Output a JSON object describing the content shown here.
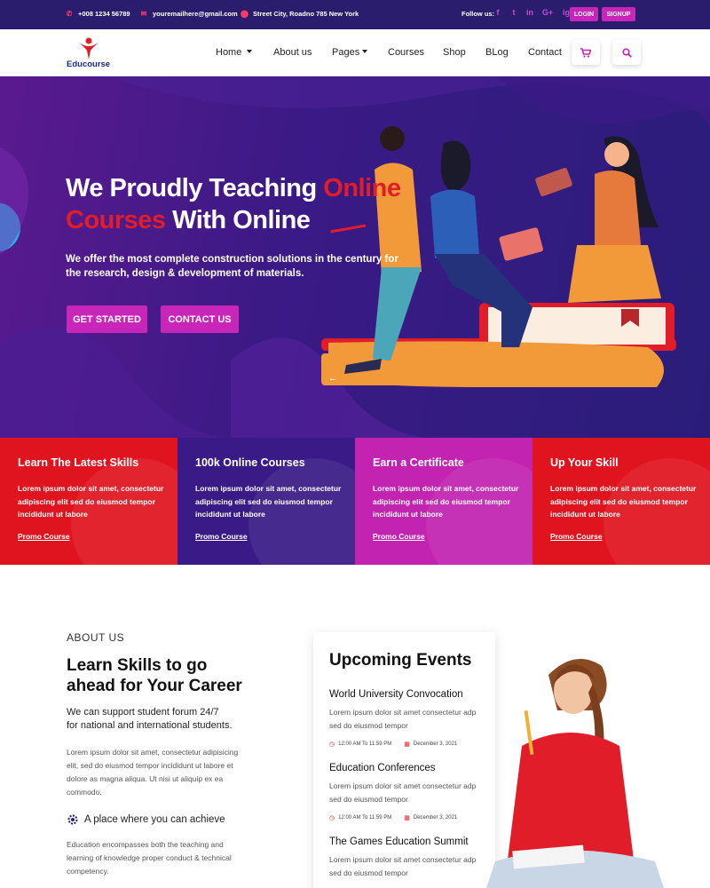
{
  "topbar": {
    "phone": "+008 1234 56789",
    "email": "youremailhere@gmail.com",
    "address": "Street City, Roadno 785 New York",
    "follow_label": "Follow us:",
    "socials": [
      "f",
      "t",
      "in",
      "G+",
      "ig"
    ],
    "login_label": "LOGIN",
    "signup_label": "SIGNUP"
  },
  "brand": {
    "name": "Educourse",
    "accent_color": "#c826b8",
    "red_color": "#e11d2a",
    "navy_color": "#2a1d6e"
  },
  "nav": {
    "items": [
      "Home",
      "About us",
      "Pages",
      "Courses",
      "Shop",
      "BLog",
      "Contact"
    ],
    "icons": [
      "cart-icon",
      "search-icon"
    ]
  },
  "hero": {
    "title_part1": "We Proudly Teaching ",
    "title_highlight1": "Online",
    "title_highlight2": "Courses",
    "title_part2": " With Online",
    "subtitle": "We offer the most complete construction solutions in the century for the research, design & development of materials.",
    "btn_primary": "GET STARTED",
    "btn_secondary": "CONTACT US"
  },
  "features": [
    {
      "title": "Learn The Latest Skills",
      "text": "Lorem ipsum dolor sit amet, consectetur adipiscing elit sed do eiusmod tempor incididunt ut labore",
      "link": "Promo Course",
      "color": "#e0141f"
    },
    {
      "title": "100k Online Courses",
      "text": "Lorem ipsum dolor sit amet, consectetur adipiscing elit sed do eiusmod tempor incididunt ut labore",
      "link": "Promo Course",
      "color": "#3a1a86"
    },
    {
      "title": "Earn a Certificate",
      "text": "Lorem ipsum dolor sit amet, consectetur adipiscing elit sed do eiusmod tempor incididunt ut labore",
      "link": "Promo Course",
      "color": "#c223b0"
    },
    {
      "title": "Up Your Skill",
      "text": "Lorem ipsum dolor sit amet, consectetur adipiscing elit sed do eiusmod tempor incididunt ut labore",
      "link": "Promo Course",
      "color": "#e0141f"
    }
  ],
  "about": {
    "eyebrow": "ABOUT US",
    "title_line1": "Learn Skills to go",
    "title_line2": "ahead for Your Career",
    "lead_line1": "We can support student forum 24/7",
    "lead_line2": "for national and international students.",
    "text": "Lorem ipsum dolor sit amet, consectetur adipisicing elit, sed do eiusmod tempor incididunt ut labore et dolore as magna aliqua. Ut nisi ut aliquip ex ea commodo.",
    "point": "A place where you can achieve",
    "point_text": "Education encompasses both the teaching and learning of knowledge proper conduct & technical competency."
  },
  "events": {
    "title": "Upcoming Events",
    "items": [
      {
        "title": "World University Convocation",
        "desc": "Lorem ipsum dolor sit amet consectetur adp sed do eiusmod tempor",
        "time": "12:00 AM To 11:59 PM",
        "date": "December 3, 2021"
      },
      {
        "title": "Education Conferences",
        "desc": "Lorem ipsum dolor sit amet consectetur adp sed do eiusmod tempor",
        "time": "12:00 AM To 11:59 PM",
        "date": "December 3, 2021"
      },
      {
        "title": "The Games Education Summit",
        "desc": "Lorem ipsum dolor sit amet consectetur adp sed do eiusmod tempor",
        "time": "",
        "date": ""
      }
    ]
  }
}
